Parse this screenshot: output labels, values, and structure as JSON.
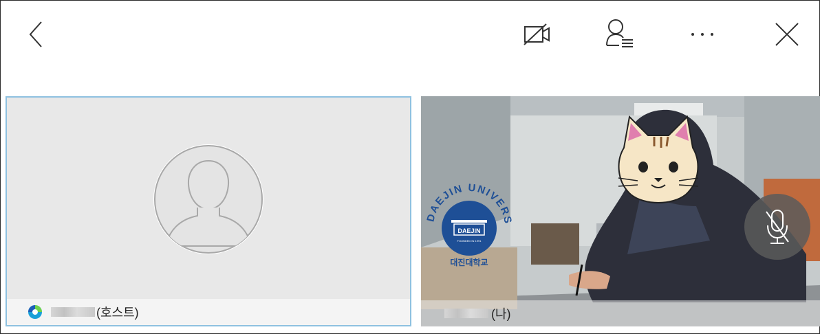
{
  "left_tile": {
    "participant_suffix": "(호스트)"
  },
  "right_tile": {
    "participant_suffix": "(나)",
    "logo_text": "DAEJIN UNIVERSITY",
    "logo_center": "DAEJIN",
    "logo_founded": "FOUNDED IN 1991",
    "logo_korean": "대진대학교"
  },
  "icons": {
    "back": "chevron-left-icon",
    "video_off": "video-off-icon",
    "participants": "participants-list-icon",
    "more": "more-horizontal-icon",
    "close": "close-icon",
    "avatar": "avatar-placeholder-icon",
    "mic_muted": "mic-muted-icon"
  },
  "colors": {
    "active_speaker_border": "#8ec1e0",
    "logo_blue": "#1e4f96"
  }
}
